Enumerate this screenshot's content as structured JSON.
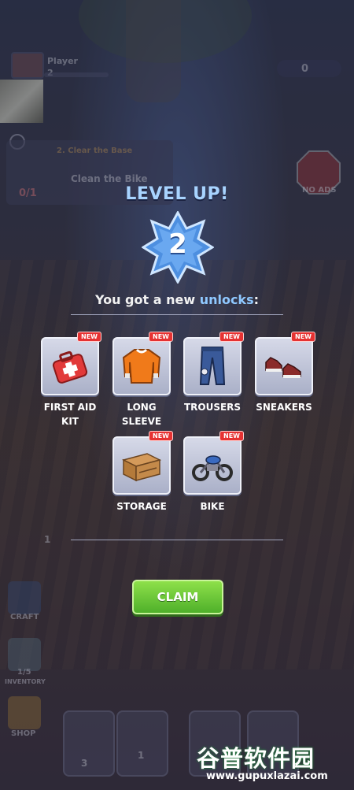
{
  "hud": {
    "player_label": "Player",
    "player_level": "2",
    "coins": "0",
    "quest_title": "2. Clear the Base",
    "quest_task": "Clean the Bike",
    "quest_progress": "0/1",
    "no_ads_label": "NO ADS",
    "craft_label": "CRAFT",
    "inventory_count": "1/5",
    "inventory_label": "INVENTORY",
    "shop_label": "SHOP",
    "slot1_count": "3",
    "slot2_count": "1",
    "ground_number": "1"
  },
  "popup": {
    "title": "LEVEL UP!",
    "level": "2",
    "subtitle_prefix": "You got a new ",
    "subtitle_highlight": "unlocks",
    "subtitle_suffix": ":",
    "new_tag": "NEW",
    "items": [
      {
        "label": "FIRST AID KIT",
        "icon": "first-aid-kit-icon"
      },
      {
        "label": "LONG SLEEVE",
        "icon": "long-sleeve-shirt-icon"
      },
      {
        "label": "TROUSERS",
        "icon": "trousers-icon"
      },
      {
        "label": "SNEAKERS",
        "icon": "sneakers-icon"
      },
      {
        "label": "STORAGE",
        "icon": "storage-crate-icon"
      },
      {
        "label": "BIKE",
        "icon": "motorbike-icon"
      }
    ],
    "claim_label": "CLAIM"
  },
  "watermark": {
    "chinese": "谷普软件园",
    "url": "www.gupuxlazai.com"
  },
  "colors": {
    "title": "#a8d4ff",
    "highlight": "#8fc8ff",
    "badge": "#4d8fe0",
    "new_tag": "#e63232",
    "claim": "#5cc030"
  }
}
